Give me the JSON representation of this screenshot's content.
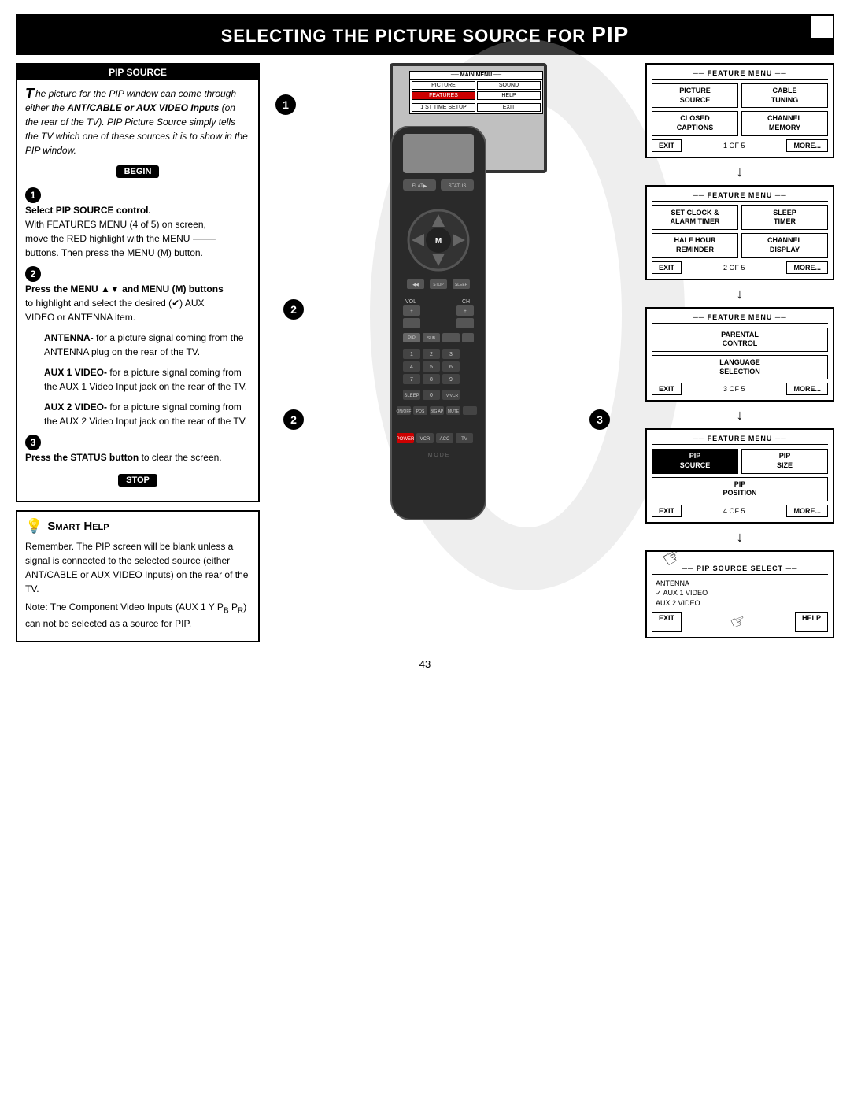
{
  "header": {
    "title": "Selecting the Picture Source for PIP",
    "small_title": "S",
    "title_rest": "electing the ",
    "pic": "P",
    "pic_rest": "icture ",
    "src": "S",
    "src_rest": "ource for "
  },
  "pip_source": {
    "title": "PIP SOURCE",
    "intro_text": "The picture for the PIP window can come through either the ANT/CABLE or AUX VIDEO Inputs (on the rear of the TV). PIP Picture Source simply tells the TV which one of these sources it is to show in the PIP window.",
    "begin_label": "BEGIN",
    "steps": [
      {
        "num": "1",
        "bold": "Select PIP SOURCE control.",
        "detail": "With FEATURES MENU (4 of 5) on screen, move the RED highlight with the MENU buttons. Then press the MENU (M) button."
      },
      {
        "num": "2",
        "bold": "Press the MENU ▲▼ and MENU (M) buttons",
        "detail": "to highlight and select the desired (✔) AUX VIDEO or ANTENNA item."
      },
      {
        "bold_extra": "ANTENNA-",
        "detail": "for a picture signal coming from the ANTENNA plug on the rear of the TV."
      },
      {
        "bold_extra": "AUX 1 VIDEO-",
        "detail": "for a picture signal coming from the AUX 1 Video Input jack on the rear of the TV."
      },
      {
        "bold_extra": "AUX 2 VIDEO-",
        "detail": "for a picture signal coming from the AUX 2 Video Input jack on the rear of the TV."
      },
      {
        "num": "3",
        "bold": "Press the STATUS button",
        "detail": "to clear the screen."
      }
    ],
    "stop_label": "STOP"
  },
  "smart_help": {
    "title": "Smart Help",
    "title_small": "S",
    "paras": [
      "Remember. The PIP screen will be blank unless a signal is connected to the selected source (either ANT/CABLE or AUX VIDEO Inputs) on the rear of the TV.",
      "Note: The Component Video Inputs (AUX 1 Y PB PR) can not be selected as a source for PIP."
    ]
  },
  "tv_menu": {
    "title": "MAIN MENU",
    "items": [
      {
        "label": "PICTURE",
        "highlight": false
      },
      {
        "label": "SOUND",
        "highlight": false
      },
      {
        "label": "FEATURES",
        "highlight": true
      },
      {
        "label": "HELP",
        "highlight": false
      },
      {
        "label": "1 ST TIME SETUP",
        "highlight": false,
        "full": true
      },
      {
        "label": "EXIT",
        "highlight": false,
        "full": true
      }
    ]
  },
  "feature_menus": [
    {
      "title": "FEATURE MENU",
      "page": "1 OF 5",
      "items": [
        {
          "label": "PICTURE\nSOURCE"
        },
        {
          "label": "CABLE\nTUNING"
        },
        {
          "label": "CLOSED\nCAPTIONS"
        },
        {
          "label": "CHANNEL\nMEMORY"
        }
      ],
      "exit": "EXIT",
      "more": "MORE..."
    },
    {
      "title": "FEATURE MENU",
      "page": "2 OF 5",
      "items": [
        {
          "label": "SET CLOCK &\nALARM TIMER"
        },
        {
          "label": "SLEEP\nTIMER"
        },
        {
          "label": "HALF HOUR\nREMINDER"
        },
        {
          "label": "CHANNEL\nDISPLAY"
        }
      ],
      "exit": "EXIT",
      "more": "MORE..."
    },
    {
      "title": "FEATURE MENU",
      "page": "3 OF 5",
      "items": [
        {
          "label": "PARENTAL\nCONTROL",
          "full": true
        },
        {
          "label": "LANGUAGE\nSELECTION",
          "full": true
        }
      ],
      "exit": "EXIT",
      "more": "MORE..."
    },
    {
      "title": "FEATURE MENU",
      "page": "4 OF 5",
      "items": [
        {
          "label": "PIP\nSOURCE"
        },
        {
          "label": "PIP\nSIZE"
        },
        {
          "label": "PIP\nPOSITION",
          "full": true
        }
      ],
      "exit": "EXIT",
      "more": "MORE..."
    }
  ],
  "pip_source_select": {
    "title": "PIP SOURCE SELECT",
    "options": [
      {
        "label": "ANTENNA",
        "checked": false
      },
      {
        "label": "AUX 1 VIDEO",
        "checked": true
      },
      {
        "label": "AUX 2 VIDEO",
        "checked": false
      }
    ],
    "exit": "EXIT",
    "help": "HELP"
  },
  "page_number": "43",
  "remote_buttons": {
    "flat": "FLAT▶",
    "status": "STATUS",
    "m": "M",
    "vol": "VOL",
    "ch": "CH",
    "pip_label": "PIP",
    "sub": "SUB",
    "power": "POWER",
    "vcr": "VCR",
    "acc": "ACC",
    "tv": "TV",
    "mode": "MODE"
  }
}
